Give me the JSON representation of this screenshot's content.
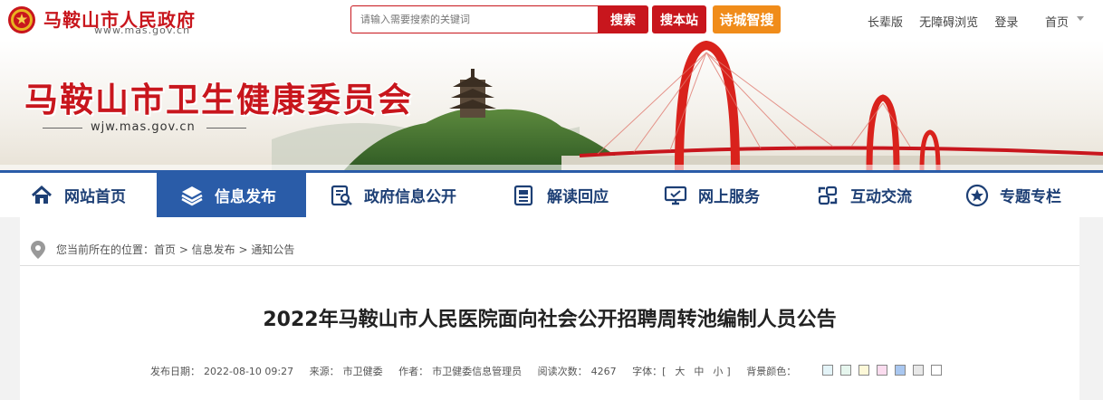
{
  "header": {
    "gov_name": "马鞍山市人民政府",
    "gov_url": "www.mas.gov.cn",
    "search_placeholder": "请输入需要搜索的关键词",
    "search_label": "搜索",
    "site_search_label": "搜本站",
    "smart_search_label": "诗城智搜",
    "links": [
      "长辈版",
      "无障碍浏览",
      "登录"
    ],
    "home_label": "首页"
  },
  "banner": {
    "dept_name": "马鞍山市卫生健康委员会",
    "dept_url": "wjw.mas.gov.cn"
  },
  "nav": {
    "items": [
      {
        "label": "网站首页",
        "icon": "home-icon"
      },
      {
        "label": "信息发布",
        "icon": "layers-icon"
      },
      {
        "label": "政府信息公开",
        "icon": "document-search-icon"
      },
      {
        "label": "解读回应",
        "icon": "news-icon"
      },
      {
        "label": "网上服务",
        "icon": "monitor-icon"
      },
      {
        "label": "互动交流",
        "icon": "interaction-icon"
      },
      {
        "label": "专题专栏",
        "icon": "star-icon"
      }
    ],
    "active_index": 1
  },
  "breadcrumb": "您当前所在的位置：首页 > 信息发布 > 通知公告",
  "article": {
    "title": "2022年马鞍山市人民医院面向社会公开招聘周转池编制人员公告",
    "date_label": "发布日期：",
    "date": "2022-08-10 09:27",
    "source_label": "来源：",
    "source": "市卫健委",
    "author_label": "作者：",
    "author": "市卫健委信息管理员",
    "views_label": "阅读次数：",
    "views": "4267",
    "font_label": "字体：[",
    "font_sizes": [
      "大",
      "中",
      "小"
    ],
    "font_close": "]",
    "bg_label": "背景颜色："
  },
  "colors": {
    "brand_red": "#c8161d",
    "nav_blue": "#2a5ca8",
    "orange": "#f08c1a",
    "swatches": [
      "#e4f4f8",
      "#e6f6ee",
      "#fdf8d8",
      "#fbdcef",
      "#a9c7f0",
      "#e8e8e8",
      "#ffffff"
    ]
  }
}
